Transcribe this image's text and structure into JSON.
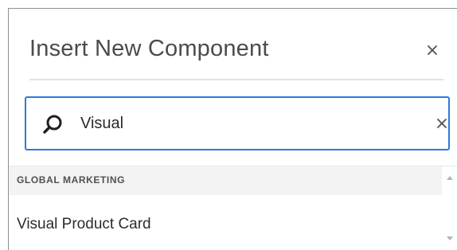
{
  "dialog": {
    "title": "Insert New Component",
    "close_icon": "close-icon"
  },
  "search": {
    "value": "Visual",
    "search_icon": "search-icon",
    "clear_icon": "clear-icon",
    "accent_color": "#2c7bd9"
  },
  "results": {
    "groups": [
      {
        "label": "GLOBAL MARKETING",
        "items": [
          {
            "label": "Visual Product Card"
          }
        ]
      }
    ],
    "scroll_up_icon": "scroll-up-arrow-icon",
    "scroll_down_icon": "scroll-down-arrow-icon"
  }
}
